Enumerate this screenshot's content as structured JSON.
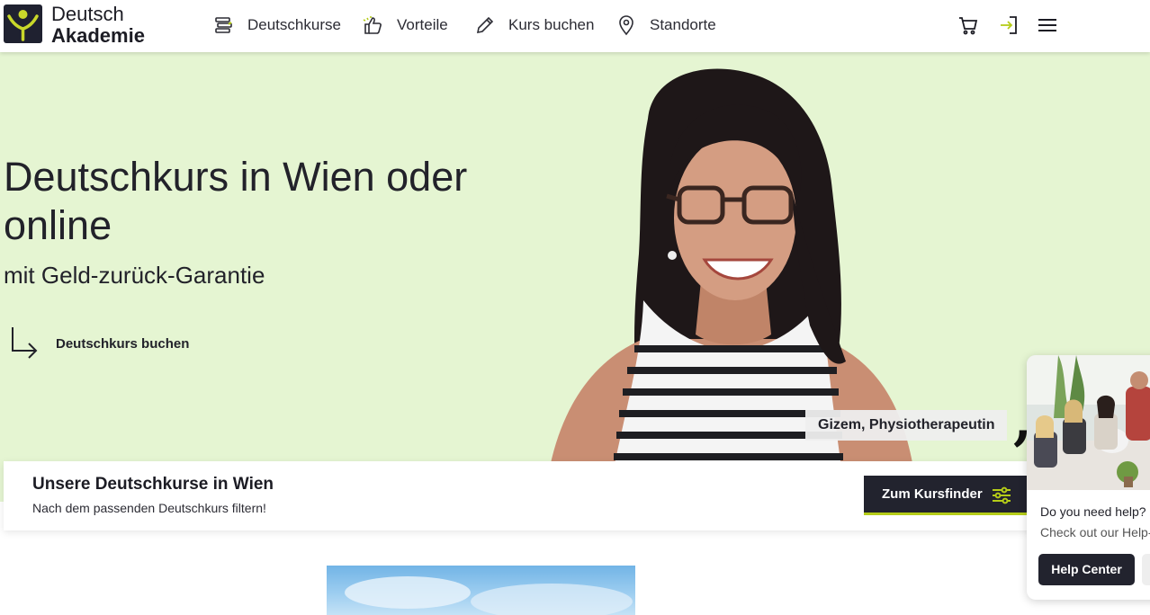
{
  "header": {
    "logo_line1": "Deutsch",
    "logo_line2": "Akademie",
    "nav": [
      {
        "label": "Deutschkurse",
        "icon": "books-icon"
      },
      {
        "label": "Vorteile",
        "icon": "thumbs-up-icon"
      },
      {
        "label": "Kurs buchen",
        "icon": "pencil-icon"
      },
      {
        "label": "Standorte",
        "icon": "location-pin-icon"
      }
    ],
    "right_icons": [
      "cart-icon",
      "login-icon",
      "menu-icon"
    ]
  },
  "hero": {
    "title": "Deutschkurs in Wien oder online",
    "subtitle": "mit Geld-zurück-Garantie",
    "cta_label": "Deutschkurs buchen",
    "testimonial": "Gizem, Physiotherapeutin",
    "quote_mark": ","
  },
  "course_bar": {
    "title": "Unsere Deutschkurse in Wien",
    "subtitle": "Nach dem passenden Deutschkurs filtern!",
    "button_label": "Zum Kursfinder"
  },
  "help_widget": {
    "question": "Do you need help?",
    "subtext": "Check out our Help-",
    "button_label": "Help Center"
  },
  "colors": {
    "hero_bg": "#e5f5d2",
    "dark": "#22232e",
    "accent": "#b5cc18"
  }
}
